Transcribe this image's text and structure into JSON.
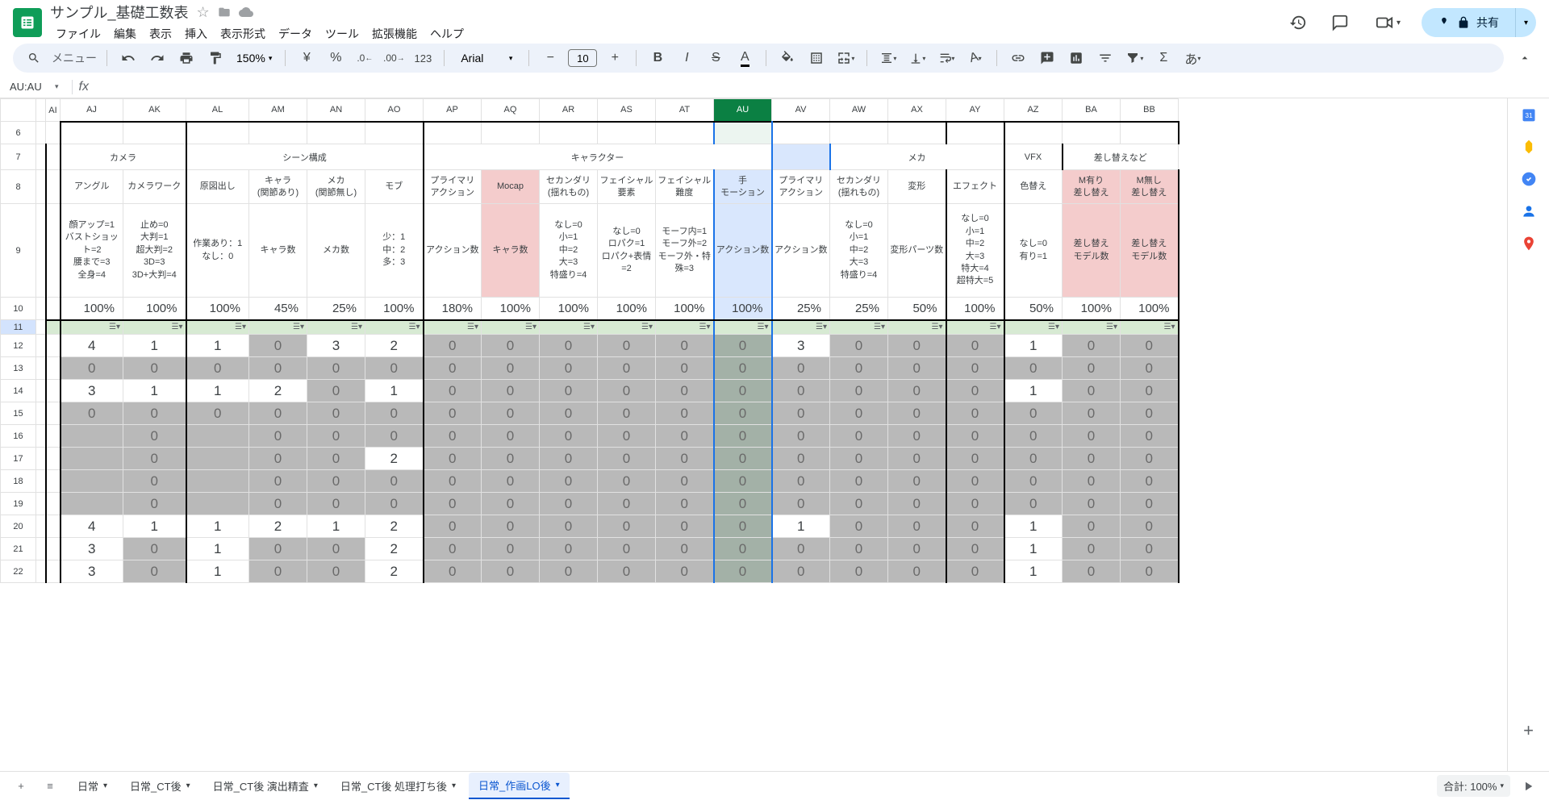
{
  "docTitle": "サンプル_基礎工数表",
  "menus": [
    "ファイル",
    "編集",
    "表示",
    "挿入",
    "表示形式",
    "データ",
    "ツール",
    "拡張機能",
    "ヘルプ"
  ],
  "searchPlaceholder": "メニュー",
  "zoom": "150%",
  "font": "Arial",
  "fontSize": "10",
  "shareLabel": "共有",
  "nameBox": "AU:AU",
  "statusSum": "合計: 100%",
  "cols": [
    "AI",
    "AJ",
    "AK",
    "AL",
    "AM",
    "AN",
    "AO",
    "AP",
    "AQ",
    "AR",
    "AS",
    "AT",
    "AU",
    "AV",
    "AW",
    "AX",
    "AY",
    "AZ",
    "BA",
    "BB"
  ],
  "selectedCol": "AU",
  "rows": [
    "6",
    "7",
    "8",
    "9",
    "10",
    "11",
    "12",
    "13",
    "14",
    "15",
    "16",
    "17",
    "18",
    "19",
    "20",
    "21",
    "22"
  ],
  "groupHeaders": {
    "camera": "カメラ",
    "scene": "シーン構成",
    "character": "キャラクター",
    "mecha": "メカ",
    "vfx": "VFX",
    "replace": "差し替えなど"
  },
  "subHeaders": {
    "AJ": "アングル",
    "AK": "カメラワーク",
    "AL": "原図出し",
    "AM": "キャラ\n(関節あり)",
    "AN": "メカ\n(関節無し)",
    "AO": "モブ",
    "AP": "プライマリ\nアクション",
    "AQ": "Mocap",
    "AR": "セカンダリ\n(揺れもの)",
    "AS": "フェイシャル\n要素",
    "AT": "フェイシャル\n難度",
    "AU": "手\nモーション",
    "AV": "プライマリ\nアクション",
    "AW": "セカンダリ\n(揺れもの)",
    "AX": "変形",
    "AY": "エフェクト",
    "AZ": "色替え",
    "BA": "M有り\n差し替え",
    "BB": "M無し\n差し替え"
  },
  "descHeaders": {
    "AJ": "顔アップ=1\nバストショット=2\n腰まで=3\n全身=4",
    "AK": "止め=0\n大判=1\n超大判=2\n3D=3\n3D+大判=4",
    "AL": "作業あり：1\nなし：0",
    "AM": "キャラ数",
    "AN": "メカ数",
    "AO": "少：1\n中：2\n多：3",
    "AP": "アクション数",
    "AQ": "キャラ数",
    "AR": "なし=0\n小=1\n中=2\n大=3\n特盛り=4",
    "AS": "なし=0\nロパク=1\nロパク+表情=2",
    "AT": "モーフ内=1\nモーフ外=2\nモーフ外・特殊=3",
    "AU": "アクション数",
    "AV": "アクション数",
    "AW": "なし=0\n小=1\n中=2\n大=3\n特盛り=4",
    "AX": "変形パーツ数",
    "AY": "なし=0\n小=1\n中=2\n大=3\n特大=4\n超特大=5",
    "AZ": "なし=0\n有り=1",
    "BA": "差し替え\nモデル数",
    "BB": "差し替え\nモデル数"
  },
  "pctRow": {
    "AJ": "100%",
    "AK": "100%",
    "AL": "100%",
    "AM": "45%",
    "AN": "25%",
    "AO": "100%",
    "AP": "180%",
    "AQ": "100%",
    "AR": "100%",
    "AS": "100%",
    "AT": "100%",
    "AU": "100%",
    "AV": "25%",
    "AW": "25%",
    "AX": "50%",
    "AY": "100%",
    "AZ": "50%",
    "BA": "100%",
    "BB": "100%"
  },
  "dataRows": [
    {
      "r": "12",
      "AJ": "4",
      "AK": "1",
      "AL": "1",
      "AM": "0",
      "AN": "3",
      "AO": "2",
      "AP": "0",
      "AQ": "0",
      "AR": "0",
      "AS": "0",
      "AT": "0",
      "AU": "0",
      "AV": "3",
      "AW": "0",
      "AX": "0",
      "AY": "0",
      "AZ": "1",
      "BA": "0",
      "BB": "0",
      "white": [
        "AJ",
        "AK",
        "AL",
        "AN",
        "AO",
        "AV",
        "AZ"
      ]
    },
    {
      "r": "13",
      "AJ": "0",
      "AK": "0",
      "AL": "0",
      "AM": "0",
      "AN": "0",
      "AO": "0",
      "AP": "0",
      "AQ": "0",
      "AR": "0",
      "AS": "0",
      "AT": "0",
      "AU": "0",
      "AV": "0",
      "AW": "0",
      "AX": "0",
      "AY": "0",
      "AZ": "0",
      "BA": "0",
      "BB": "0",
      "white": []
    },
    {
      "r": "14",
      "AJ": "3",
      "AK": "1",
      "AL": "1",
      "AM": "2",
      "AN": "0",
      "AO": "1",
      "AP": "0",
      "AQ": "0",
      "AR": "0",
      "AS": "0",
      "AT": "0",
      "AU": "0",
      "AV": "0",
      "AW": "0",
      "AX": "0",
      "AY": "0",
      "AZ": "1",
      "BA": "0",
      "BB": "0",
      "white": [
        "AJ",
        "AK",
        "AL",
        "AM",
        "AO",
        "AZ"
      ]
    },
    {
      "r": "15",
      "AJ": "0",
      "AK": "0",
      "AL": "0",
      "AM": "0",
      "AN": "0",
      "AO": "0",
      "AP": "0",
      "AQ": "0",
      "AR": "0",
      "AS": "0",
      "AT": "0",
      "AU": "0",
      "AV": "0",
      "AW": "0",
      "AX": "0",
      "AY": "0",
      "AZ": "0",
      "BA": "0",
      "BB": "0",
      "white": []
    },
    {
      "r": "16",
      "AJ": "",
      "AK": "0",
      "AL": "",
      "AM": "0",
      "AN": "0",
      "AO": "0",
      "AP": "0",
      "AQ": "0",
      "AR": "0",
      "AS": "0",
      "AT": "0",
      "AU": "0",
      "AV": "0",
      "AW": "0",
      "AX": "0",
      "AY": "0",
      "AZ": "0",
      "BA": "0",
      "BB": "0",
      "white": []
    },
    {
      "r": "17",
      "AJ": "",
      "AK": "0",
      "AL": "",
      "AM": "0",
      "AN": "0",
      "AO": "2",
      "AP": "0",
      "AQ": "0",
      "AR": "0",
      "AS": "0",
      "AT": "0",
      "AU": "0",
      "AV": "0",
      "AW": "0",
      "AX": "0",
      "AY": "0",
      "AZ": "0",
      "BA": "0",
      "BB": "0",
      "white": [
        "AO"
      ]
    },
    {
      "r": "18",
      "AJ": "",
      "AK": "0",
      "AL": "",
      "AM": "0",
      "AN": "0",
      "AO": "0",
      "AP": "0",
      "AQ": "0",
      "AR": "0",
      "AS": "0",
      "AT": "0",
      "AU": "0",
      "AV": "0",
      "AW": "0",
      "AX": "0",
      "AY": "0",
      "AZ": "0",
      "BA": "0",
      "BB": "0",
      "white": []
    },
    {
      "r": "19",
      "AJ": "",
      "AK": "0",
      "AL": "",
      "AM": "0",
      "AN": "0",
      "AO": "0",
      "AP": "0",
      "AQ": "0",
      "AR": "0",
      "AS": "0",
      "AT": "0",
      "AU": "0",
      "AV": "0",
      "AW": "0",
      "AX": "0",
      "AY": "0",
      "AZ": "0",
      "BA": "0",
      "BB": "0",
      "white": []
    },
    {
      "r": "20",
      "AJ": "4",
      "AK": "1",
      "AL": "1",
      "AM": "2",
      "AN": "1",
      "AO": "2",
      "AP": "0",
      "AQ": "0",
      "AR": "0",
      "AS": "0",
      "AT": "0",
      "AU": "0",
      "AV": "1",
      "AW": "0",
      "AX": "0",
      "AY": "0",
      "AZ": "1",
      "BA": "0",
      "BB": "0",
      "white": [
        "AJ",
        "AK",
        "AL",
        "AM",
        "AN",
        "AO",
        "AV",
        "AZ"
      ]
    },
    {
      "r": "21",
      "AJ": "3",
      "AK": "0",
      "AL": "1",
      "AM": "0",
      "AN": "0",
      "AO": "2",
      "AP": "0",
      "AQ": "0",
      "AR": "0",
      "AS": "0",
      "AT": "0",
      "AU": "0",
      "AV": "0",
      "AW": "0",
      "AX": "0",
      "AY": "0",
      "AZ": "1",
      "BA": "0",
      "BB": "0",
      "white": [
        "AJ",
        "AL",
        "AO",
        "AZ"
      ]
    },
    {
      "r": "22",
      "AJ": "3",
      "AK": "0",
      "AL": "1",
      "AM": "0",
      "AN": "0",
      "AO": "2",
      "AP": "0",
      "AQ": "0",
      "AR": "0",
      "AS": "0",
      "AT": "0",
      "AU": "0",
      "AV": "0",
      "AW": "0",
      "AX": "0",
      "AY": "0",
      "AZ": "1",
      "BA": "0",
      "BB": "0",
      "white": [
        "AJ",
        "AL",
        "AO",
        "AZ"
      ]
    }
  ],
  "sheetTabs": [
    {
      "name": "日常",
      "dd": true
    },
    {
      "name": "日常_CT後",
      "dd": true
    },
    {
      "name": "日常_CT後 演出精査",
      "dd": true
    },
    {
      "name": "日常_CT後 処理打ち後",
      "dd": true
    },
    {
      "name": "日常_作画LO後",
      "dd": true,
      "active": true
    }
  ]
}
